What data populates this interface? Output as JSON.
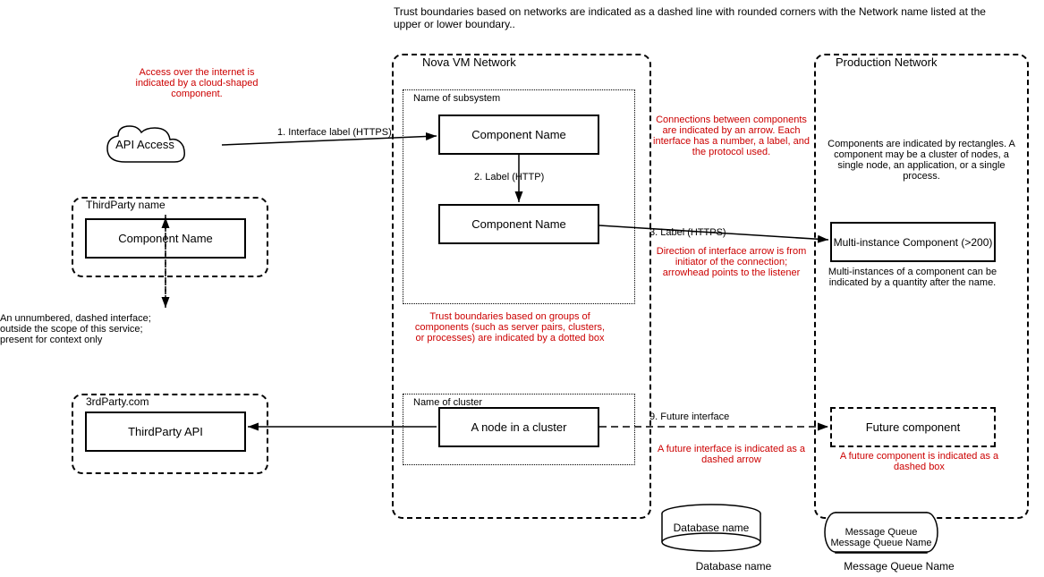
{
  "top_note": "Trust boundaries based on networks are indicated as a dashed line with rounded corners with the Network name listed at the upper or lower boundary..",
  "nova_network_label": "Nova VM Network",
  "prod_network_label": "Production Network",
  "subsystem_label": "Name of subsystem",
  "cluster_label": "Name of cluster",
  "thirdparty_boundary_label": "ThirdParty name",
  "thirdparty2_boundary_label": "3rdParty.com",
  "cloud_label": "API Access",
  "component1_label": "Component Name",
  "component2_label": "Component Name",
  "component3_label": "A node in a cluster",
  "component_thirdparty_label": "Component Name",
  "component_thirdparty_api_label": "ThirdParty API",
  "multi_instance_label": "Multi-instance Component (>200)",
  "future_component_label": "Future component",
  "interface1_label": "1. Interface label (HTTPS)",
  "interface2_label": "2.  Label (HTTP)",
  "interface3_label": "3.  Label (HTTPS)",
  "interface9_label": "9. Future interface",
  "unnumbered_label": "An unnumbered, dashed interface;\noutside the scope of this service;\npresent for context only",
  "connections_annotation": "Connections between components are indicated by an arrow. Each interface has a number, a label, and the protocol used.",
  "components_annotation": "Components are indicated by rectangles.  A component may be a cluster of nodes, a single node, an application, or a single process.",
  "direction_annotation": "Direction of interface arrow is from initiator of the connection; arrowhead points to the listener",
  "multi_instance_annotation": "Multi-instances of a component can be indicated by a quantity after the name.",
  "future_interface_annotation": "A future interface is indicated as a dashed arrow",
  "future_component_annotation": "A future component is indicated as a dashed box",
  "trust_groups_annotation": "Trust boundaries based on groups of components (such as server pairs, clusters, or processes) are indicated by a dotted box",
  "internet_annotation": "Access over the internet is indicated by a cloud-shaped component.",
  "db_label": "Database name",
  "mq_label": "Message Queue Name"
}
